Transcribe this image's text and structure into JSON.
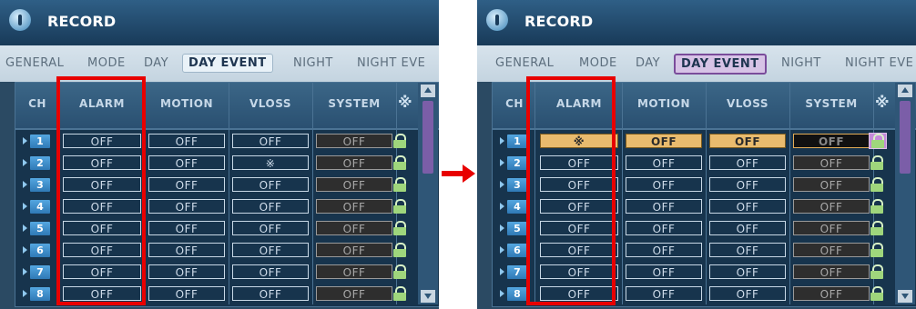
{
  "left": {
    "title": "RECORD",
    "tabs": [
      "GENERAL",
      "MODE",
      "DAY",
      "DAY EVENT",
      "NIGHT",
      "NIGHT EVE"
    ],
    "active_tab": "DAY EVENT",
    "columns": [
      "CH",
      "ALARM",
      "MOTION",
      "VLOSS",
      "SYSTEM",
      "※"
    ],
    "rows": [
      {
        "ch": "1",
        "alarm": "OFF",
        "motion": "OFF",
        "vloss": "OFF",
        "system": "OFF"
      },
      {
        "ch": "2",
        "alarm": "OFF",
        "motion": "OFF",
        "vloss": "※",
        "system": "OFF"
      },
      {
        "ch": "3",
        "alarm": "OFF",
        "motion": "OFF",
        "vloss": "OFF",
        "system": "OFF"
      },
      {
        "ch": "4",
        "alarm": "OFF",
        "motion": "OFF",
        "vloss": "OFF",
        "system": "OFF"
      },
      {
        "ch": "5",
        "alarm": "OFF",
        "motion": "OFF",
        "vloss": "OFF",
        "system": "OFF"
      },
      {
        "ch": "6",
        "alarm": "OFF",
        "motion": "OFF",
        "vloss": "OFF",
        "system": "OFF"
      },
      {
        "ch": "7",
        "alarm": "OFF",
        "motion": "OFF",
        "vloss": "OFF",
        "system": "OFF"
      },
      {
        "ch": "8",
        "alarm": "OFF",
        "motion": "OFF",
        "vloss": "OFF",
        "system": "OFF"
      }
    ]
  },
  "right": {
    "title": "RECORD",
    "tabs": [
      "GENERAL",
      "MODE",
      "DAY",
      "DAY EVENT",
      "NIGHT",
      "NIGHT EVE"
    ],
    "active_tab": "DAY EVENT",
    "columns": [
      "CH",
      "ALARM",
      "MOTION",
      "VLOSS",
      "SYSTEM",
      "※"
    ],
    "highlighted_row": "1",
    "rows": [
      {
        "ch": "1",
        "alarm": "※",
        "motion": "OFF",
        "vloss": "OFF",
        "system": "OFF"
      },
      {
        "ch": "2",
        "alarm": "OFF",
        "motion": "OFF",
        "vloss": "OFF",
        "system": "OFF"
      },
      {
        "ch": "3",
        "alarm": "OFF",
        "motion": "OFF",
        "vloss": "OFF",
        "system": "OFF"
      },
      {
        "ch": "4",
        "alarm": "OFF",
        "motion": "OFF",
        "vloss": "OFF",
        "system": "OFF"
      },
      {
        "ch": "5",
        "alarm": "OFF",
        "motion": "OFF",
        "vloss": "OFF",
        "system": "OFF"
      },
      {
        "ch": "6",
        "alarm": "OFF",
        "motion": "OFF",
        "vloss": "OFF",
        "system": "OFF"
      },
      {
        "ch": "7",
        "alarm": "OFF",
        "motion": "OFF",
        "vloss": "OFF",
        "system": "OFF"
      },
      {
        "ch": "8",
        "alarm": "OFF",
        "motion": "OFF",
        "vloss": "OFF",
        "system": "OFF"
      }
    ]
  },
  "colors": {
    "annotation_red": "#e80000",
    "highlight_row": "#e9bb6e",
    "accent_purple": "#7a4c9b"
  }
}
